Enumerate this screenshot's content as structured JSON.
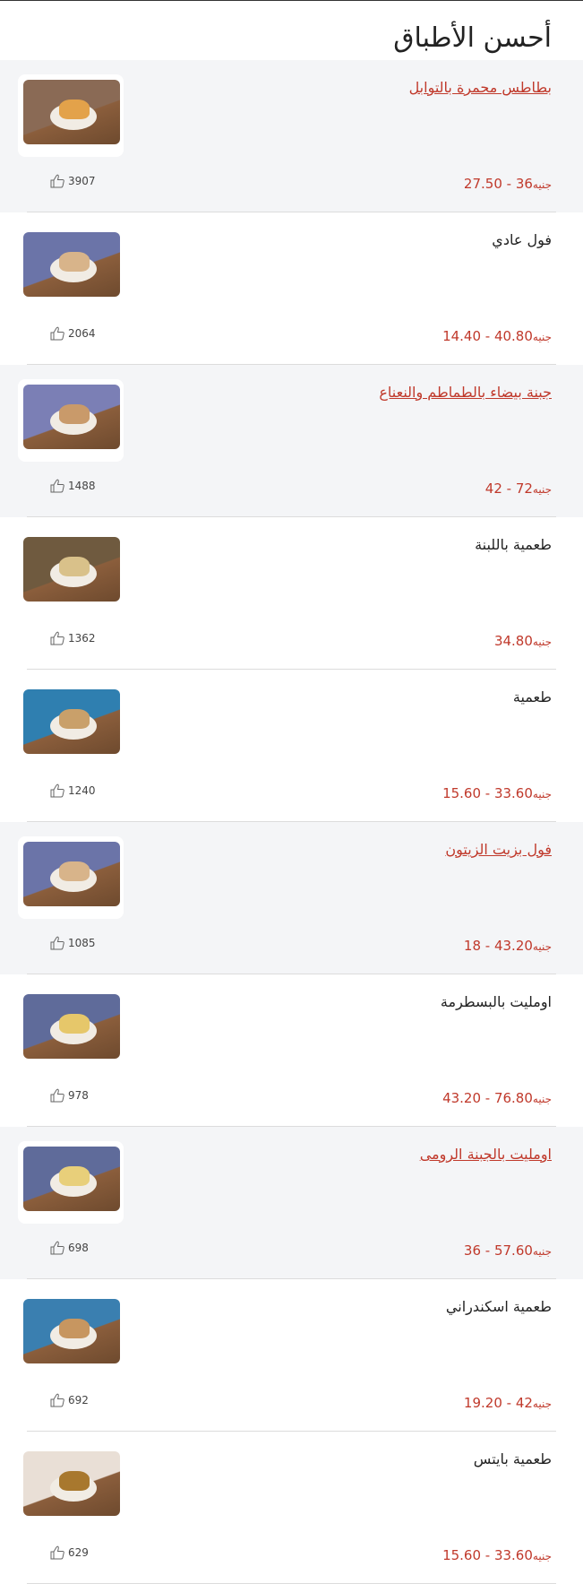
{
  "section": {
    "title": "أحسن الأطباق"
  },
  "currency": "جنيه",
  "items": [
    {
      "name": "بطاطس محمرة بالتوابل",
      "price": "27.50 - 36",
      "likes": "3907",
      "link": true,
      "shaded": true,
      "bg": "#8a6a55",
      "food": "#e3a24a"
    },
    {
      "name": "فول عادي",
      "price": "14.40 - 40.80",
      "likes": "2064",
      "link": false,
      "shaded": false,
      "bg": "#6b74a8",
      "food": "#d8b48a"
    },
    {
      "name": "جبنة بيضاء بالطماطم والنعناع",
      "price": "42 - 72",
      "likes": "1488",
      "link": true,
      "shaded": true,
      "bg": "#7b7fb5",
      "food": "#c99a6a"
    },
    {
      "name": "طعمية باللبنة",
      "price": "34.80",
      "likes": "1362",
      "link": false,
      "shaded": false,
      "bg": "#6f5a3f",
      "food": "#d9c18a"
    },
    {
      "name": "طعمية",
      "price": "15.60 - 33.60",
      "likes": "1240",
      "link": false,
      "shaded": false,
      "bg": "#2f7fb0",
      "food": "#c9a06a"
    },
    {
      "name": "فول بزيت الزيتون",
      "price": "18 - 43.20",
      "likes": "1085",
      "link": true,
      "shaded": true,
      "bg": "#6b74a8",
      "food": "#d8b48a"
    },
    {
      "name": "اومليت بالبسطرمة",
      "price": "43.20 - 76.80",
      "likes": "978",
      "link": false,
      "shaded": false,
      "bg": "#5f6b9a",
      "food": "#e6c76a"
    },
    {
      "name": "اومليت بالجبنة الرومى",
      "price": "36 - 57.60",
      "likes": "698",
      "link": true,
      "shaded": true,
      "bg": "#5f6b9a",
      "food": "#e8cf7a"
    },
    {
      "name": "طعمية اسكندراني",
      "price": "19.20 - 42",
      "likes": "692",
      "link": false,
      "shaded": false,
      "bg": "#3a7fb0",
      "food": "#c79660"
    },
    {
      "name": "طعمية بايتس",
      "price": "15.60 - 33.60",
      "likes": "629",
      "link": false,
      "shaded": false,
      "bg": "#e9dfd6",
      "food": "#a8782e"
    }
  ]
}
